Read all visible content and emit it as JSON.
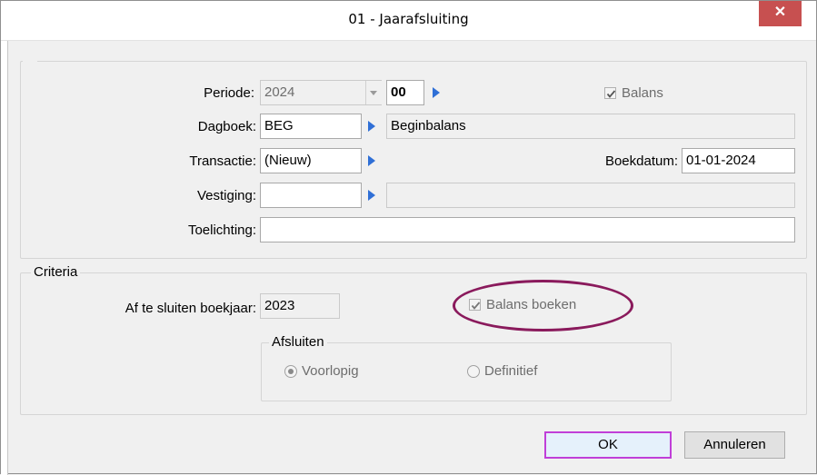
{
  "window": {
    "title": "01 - Jaarafsluiting",
    "close_label": "✕"
  },
  "form": {
    "periode": {
      "label": "Periode:",
      "year": "2024",
      "period": "00"
    },
    "balans_checkbox": {
      "label": "Balans",
      "checked": true
    },
    "dagboek": {
      "label": "Dagboek:",
      "value": "BEG",
      "description": "Beginbalans"
    },
    "transactie": {
      "label": "Transactie:",
      "value": "(Nieuw)"
    },
    "boekdatum": {
      "label": "Boekdatum:",
      "value": "01-01-2024"
    },
    "vestiging": {
      "label": "Vestiging:",
      "value": "",
      "description": ""
    },
    "toelichting": {
      "label": "Toelichting:",
      "value": ""
    }
  },
  "criteria": {
    "legend": "Criteria",
    "boekjaar": {
      "label": "Af te sluiten boekjaar:",
      "value": "2023"
    },
    "balans_boeken": {
      "label": "Balans boeken",
      "checked": true
    },
    "afsluiten": {
      "legend": "Afsluiten",
      "options": [
        {
          "label": "Voorlopig",
          "selected": true
        },
        {
          "label": "Definitief",
          "selected": false
        }
      ]
    }
  },
  "buttons": {
    "ok": "OK",
    "cancel": "Annuleren"
  },
  "colors": {
    "close_bg": "#c75050",
    "arrow": "#2f6fd6",
    "highlight_ellipse": "#8a1a5c",
    "default_button_border": "#c03fd8"
  }
}
